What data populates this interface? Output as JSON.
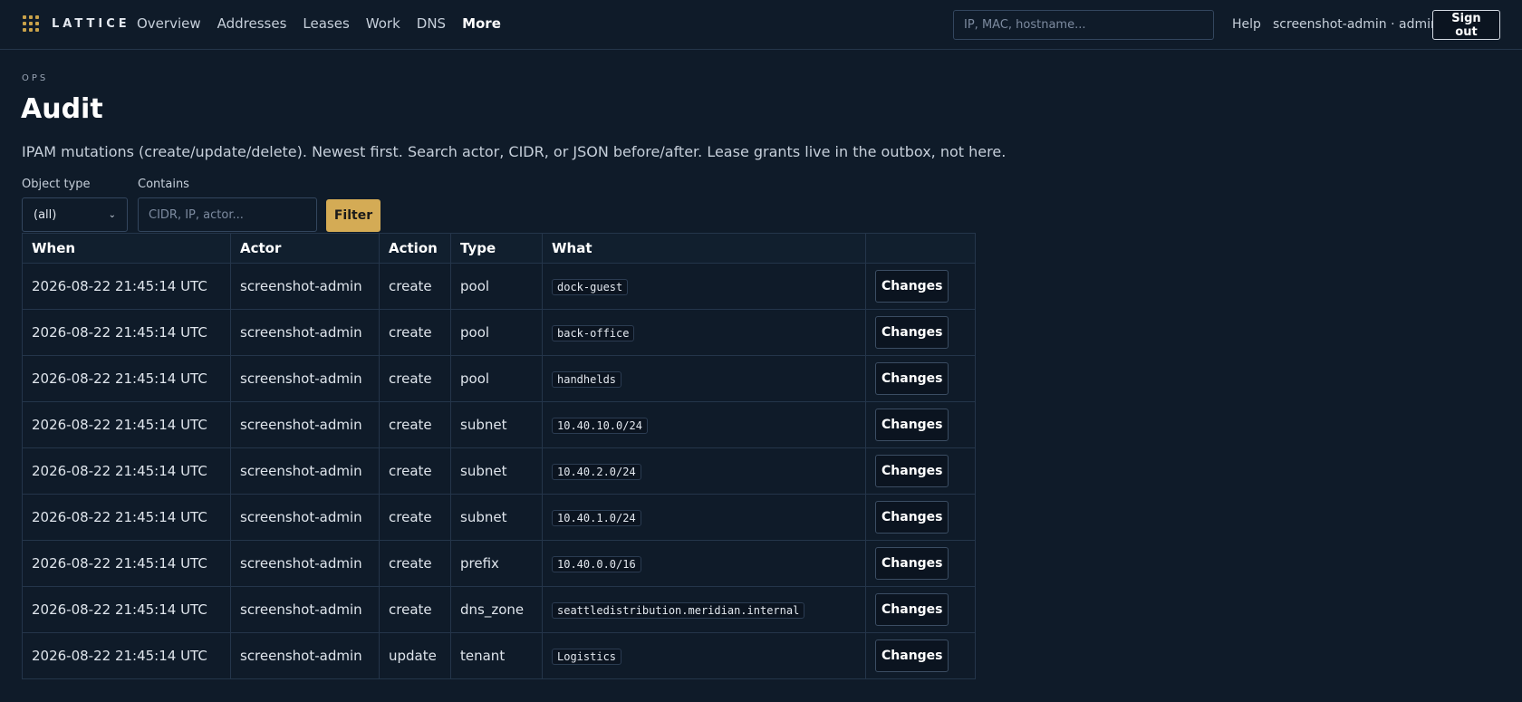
{
  "brand": {
    "name": "LATTICE"
  },
  "nav": {
    "items": [
      {
        "label": "Overview"
      },
      {
        "label": "Addresses"
      },
      {
        "label": "Leases"
      },
      {
        "label": "Work"
      },
      {
        "label": "DNS"
      },
      {
        "label": "More"
      }
    ],
    "active": "More"
  },
  "search": {
    "placeholder": "IP, MAC, hostname..."
  },
  "header": {
    "help": "Help",
    "user": "screenshot-admin · admin",
    "signout": "Sign out"
  },
  "page": {
    "eyebrow": "OPS",
    "title": "Audit",
    "description": "IPAM mutations (create/update/delete). Newest first. Search actor, CIDR, or JSON before/after. Lease grants live in the outbox, not here."
  },
  "filters": {
    "object_type_label": "Object type",
    "object_type_value": "(all)",
    "contains_label": "Contains",
    "contains_placeholder": "CIDR, IP, actor...",
    "filter_button": "Filter"
  },
  "table": {
    "columns": [
      "When",
      "Actor",
      "Action",
      "Type",
      "What",
      ""
    ],
    "changes_label": "Changes",
    "rows": [
      {
        "when": "2026-08-22 21:45:14 UTC",
        "actor": "screenshot-admin",
        "action": "create",
        "type": "pool",
        "what": "dock-guest"
      },
      {
        "when": "2026-08-22 21:45:14 UTC",
        "actor": "screenshot-admin",
        "action": "create",
        "type": "pool",
        "what": "back-office"
      },
      {
        "when": "2026-08-22 21:45:14 UTC",
        "actor": "screenshot-admin",
        "action": "create",
        "type": "pool",
        "what": "handhelds"
      },
      {
        "when": "2026-08-22 21:45:14 UTC",
        "actor": "screenshot-admin",
        "action": "create",
        "type": "subnet",
        "what": "10.40.10.0/24"
      },
      {
        "when": "2026-08-22 21:45:14 UTC",
        "actor": "screenshot-admin",
        "action": "create",
        "type": "subnet",
        "what": "10.40.2.0/24"
      },
      {
        "when": "2026-08-22 21:45:14 UTC",
        "actor": "screenshot-admin",
        "action": "create",
        "type": "subnet",
        "what": "10.40.1.0/24"
      },
      {
        "when": "2026-08-22 21:45:14 UTC",
        "actor": "screenshot-admin",
        "action": "create",
        "type": "prefix",
        "what": "10.40.0.0/16"
      },
      {
        "when": "2026-08-22 21:45:14 UTC",
        "actor": "screenshot-admin",
        "action": "create",
        "type": "dns_zone",
        "what": "seattledistribution.meridian.internal"
      },
      {
        "when": "2026-08-22 21:45:14 UTC",
        "actor": "screenshot-admin",
        "action": "update",
        "type": "tenant",
        "what": "Logistics"
      }
    ]
  },
  "colors": {
    "background": "#0f1b29",
    "accent": "#d4ab55",
    "border": "#24354a"
  }
}
